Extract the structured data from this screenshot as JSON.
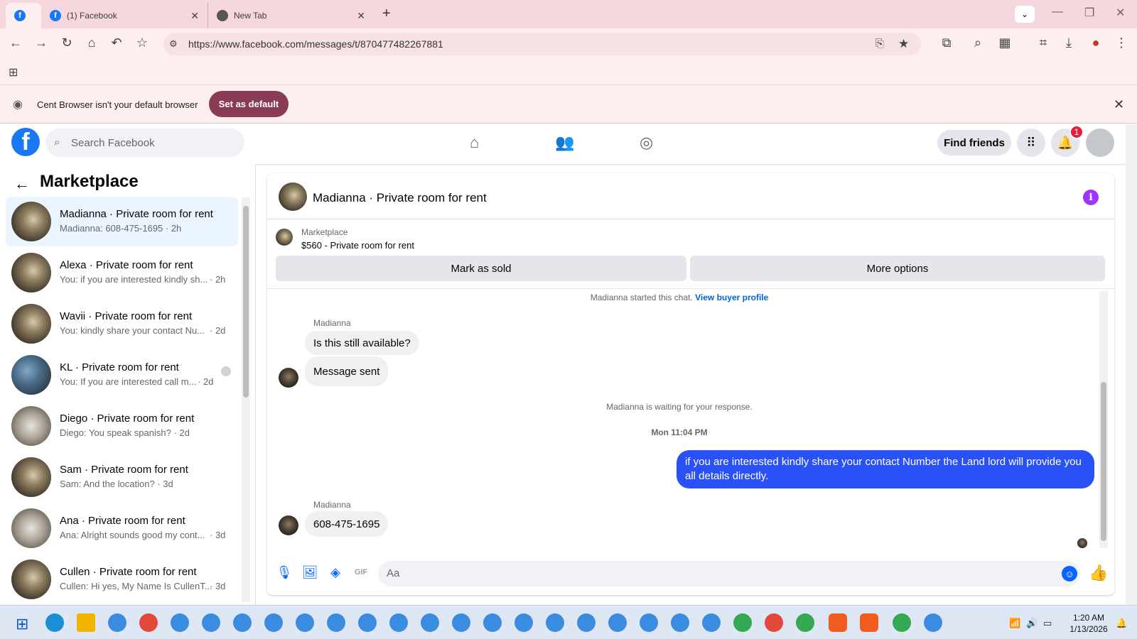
{
  "browser": {
    "tabs": [
      {
        "title": "(1) Facebook",
        "active": true
      },
      {
        "title": "New Tab",
        "active": false
      }
    ],
    "url": "https://www.facebook.com/messages/t/870477482267881",
    "infobar_text": "Cent Browser isn't your default browser",
    "infobar_button": "Set as default",
    "favicon_letter": "f"
  },
  "fb_header": {
    "logo_letter": "f",
    "search_placeholder": "Search Facebook",
    "find_friends": "Find friends",
    "notification_count": "1"
  },
  "sidebar": {
    "title": "Marketplace",
    "conversations": [
      {
        "name": "Madianna · Private room for rent",
        "snippet": "Madianna: 608-475-1695 · 2h",
        "ago": "",
        "active": true
      },
      {
        "name": "Alexa · Private room for rent",
        "snippet": "You: if you are interested kindly sh...",
        "ago": "· 2h",
        "active": false
      },
      {
        "name": "Wavii · Private room for rent",
        "snippet": "You: kindly share your contact Nu...",
        "ago": "· 2d",
        "active": false
      },
      {
        "name": "KL · Private room for rent",
        "snippet": "You: If you are interested call m...",
        "ago": "· 2d",
        "active": false
      },
      {
        "name": "Diego · Private room for rent",
        "snippet": "Diego: You speak spanish? · 2d",
        "ago": "",
        "active": false
      },
      {
        "name": "Sam · Private room for rent",
        "snippet": "Sam: And the location? · 3d",
        "ago": "",
        "active": false
      },
      {
        "name": "Ana · Private room for rent",
        "snippet": "Ana: Alright sounds good my cont...",
        "ago": "· 3d",
        "active": false
      },
      {
        "name": "Cullen · Private room for rent",
        "snippet": "Cullen: Hi yes, My Name Is CullenT...",
        "ago": "· 3d",
        "active": false
      }
    ]
  },
  "chat": {
    "title": "Madianna · Private room for rent",
    "info_glyph": "i",
    "listing_source": "Marketplace",
    "listing_title": "$560 - Private room for rent",
    "mark_sold": "Mark as sold",
    "more_options": "More options",
    "started_text": "Madianna started this chat.",
    "view_buyer_profile": "View buyer profile",
    "sender_name": "Madianna",
    "messages_in_1": [
      "Is this still available?",
      "Message sent"
    ],
    "waiting_text": "Madianna is waiting for your response.",
    "timestamp": "Mon 11:04 PM",
    "outgoing": "if you are interested kindly share your contact Number the Land lord will provide you all details directly.",
    "sender_name_2": "Madianna",
    "message_in_2": "608-475-1695",
    "composer_placeholder": "Aa"
  },
  "taskbar": {
    "time": "1:20 AM",
    "date": "1/13/2026"
  },
  "colors": {
    "fb_blue": "#1877f2",
    "outgoing_bubble": "#2951f5",
    "chrome_tab_bg": "#f6d7dd",
    "set_default_btn": "#8a3c55"
  }
}
